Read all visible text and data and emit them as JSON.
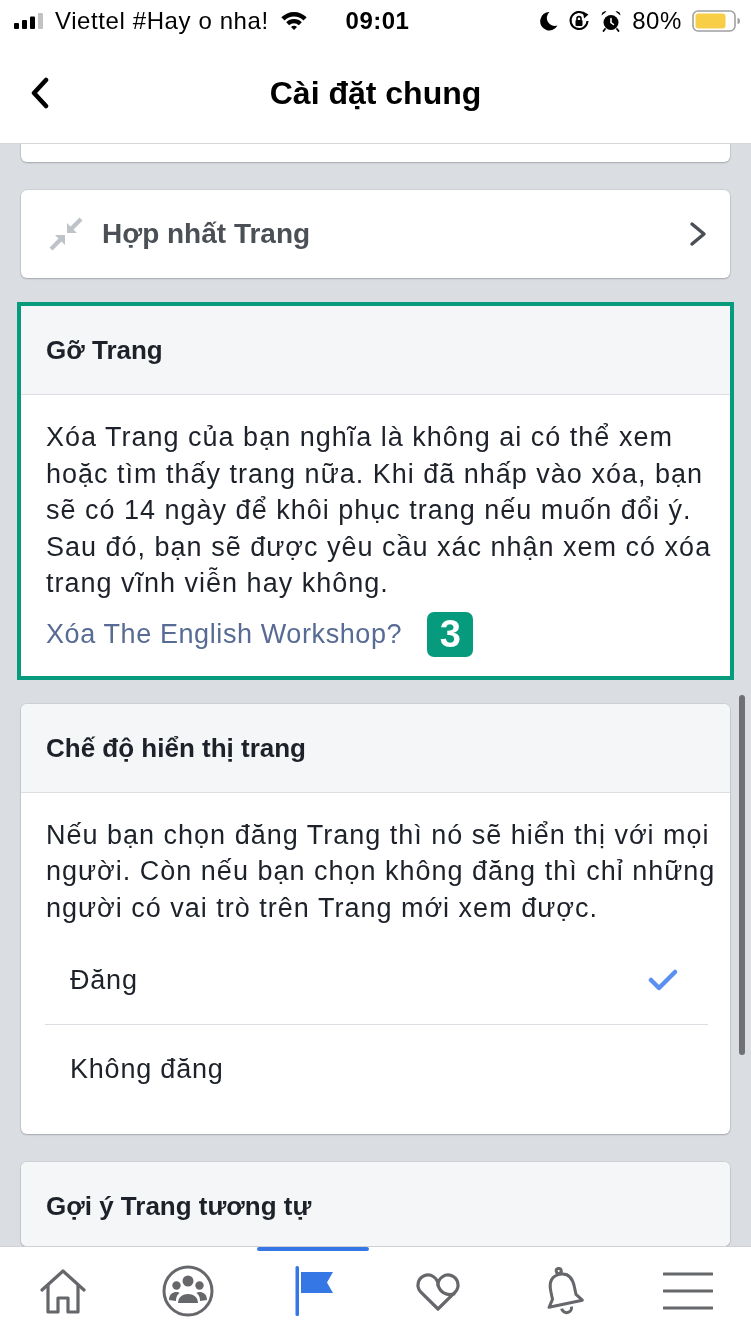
{
  "status_bar": {
    "carrier": "Viettel #Hay o nha!",
    "time": "09:01",
    "battery": "80%"
  },
  "nav_bar": {
    "title": "Cài đặt chung"
  },
  "sections": [
    {
      "kind": "blank",
      "highlighted": false
    },
    {
      "kind": "link",
      "label": "Hợp nhất Trang",
      "highlighted": false
    },
    {
      "kind": "info",
      "title": "Gỡ Trang",
      "text": "Xóa Trang của bạn nghĩa là không ai có thể xem hoặc tìm thấy trang nữa. Khi đã nhấp vào xóa, bạn sẽ có 14 ngày để khôi phục trang nếu muốn đổi ý. Sau đó, bạn sẽ được yêu cầu xác nhận xem có xóa trang vĩnh viễn hay không.",
      "link": "Xóa The English Workshop?",
      "badge": "3",
      "highlighted": true
    },
    {
      "kind": "options",
      "title": "Chế độ hiển thị trang",
      "text": "Nếu bạn chọn đăng Trang thì nó sẽ hiển thị với mọi người. Còn nếu bạn chọn không đăng thì chỉ những người có vai trò trên Trang mới xem được.",
      "options": [
        {
          "label": "Đăng",
          "selected": true
        },
        {
          "label": "Không đăng",
          "selected": false
        }
      ],
      "highlighted": false
    },
    {
      "kind": "header",
      "title": "Gợi ý Trang tương tự",
      "highlighted": false
    }
  ],
  "tab_bar": {
    "tabs": [
      {
        "selected": false
      },
      {
        "selected": false
      },
      {
        "selected": true
      },
      {
        "selected": false
      },
      {
        "selected": false
      },
      {
        "selected": false
      }
    ]
  }
}
